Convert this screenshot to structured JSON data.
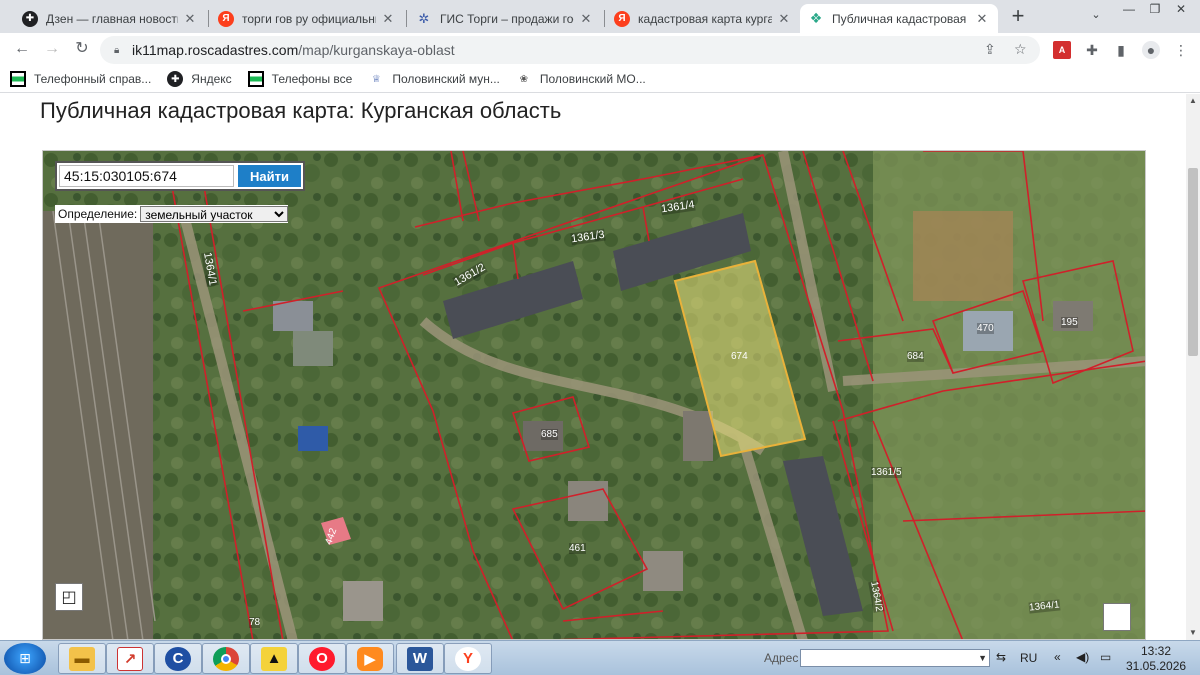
{
  "tabs": [
    {
      "title": "Дзен — главная новостная",
      "favicon": "dzen-icon",
      "active": false
    },
    {
      "title": "торги гов ру официальный",
      "favicon": "yandex-icon",
      "active": false
    },
    {
      "title": "ГИС Торги – продажи госу",
      "favicon": "gis-icon",
      "active": false
    },
    {
      "title": "кадастровая карта курганс",
      "favicon": "yandex-icon",
      "active": false
    },
    {
      "title": "Публичная кадастровая ка",
      "favicon": "cadastre-icon",
      "active": true
    }
  ],
  "address_bar": {
    "host": "ik11map.roscadastres.com",
    "path": "/map/kurganskaya-oblast"
  },
  "bookmarks": [
    {
      "label": "Телефонный справ...",
      "icon": "green-flag-icon"
    },
    {
      "label": "Яндекс",
      "icon": "dzen-icon"
    },
    {
      "label": "Телефоны все",
      "icon": "green-flag-icon"
    },
    {
      "label": "Половинский мун...",
      "icon": "eagle-icon"
    },
    {
      "label": "Половинский МО...",
      "icon": "paw-icon"
    }
  ],
  "page": {
    "title": "Публичная кадастровая карта: Курганская область"
  },
  "map": {
    "search_value": "45:15:030105:674",
    "search_button": "Найти",
    "definition_label": "Определение:",
    "definition_value": "земельный участок",
    "parcel_labels": [
      "1361/4",
      "1361/3",
      "1361/2",
      "1364/1",
      "674",
      "470",
      "195",
      "684",
      "685",
      "1361/5",
      "461",
      "442",
      "1364/2",
      "1364/1",
      "78"
    ],
    "highlight_color": "#e8e07a",
    "boundary_color": "#d0202a"
  },
  "taskbar": {
    "address_label": "Адрес",
    "lang": "RU",
    "time": "13:32",
    "date": "31.05.2026"
  }
}
